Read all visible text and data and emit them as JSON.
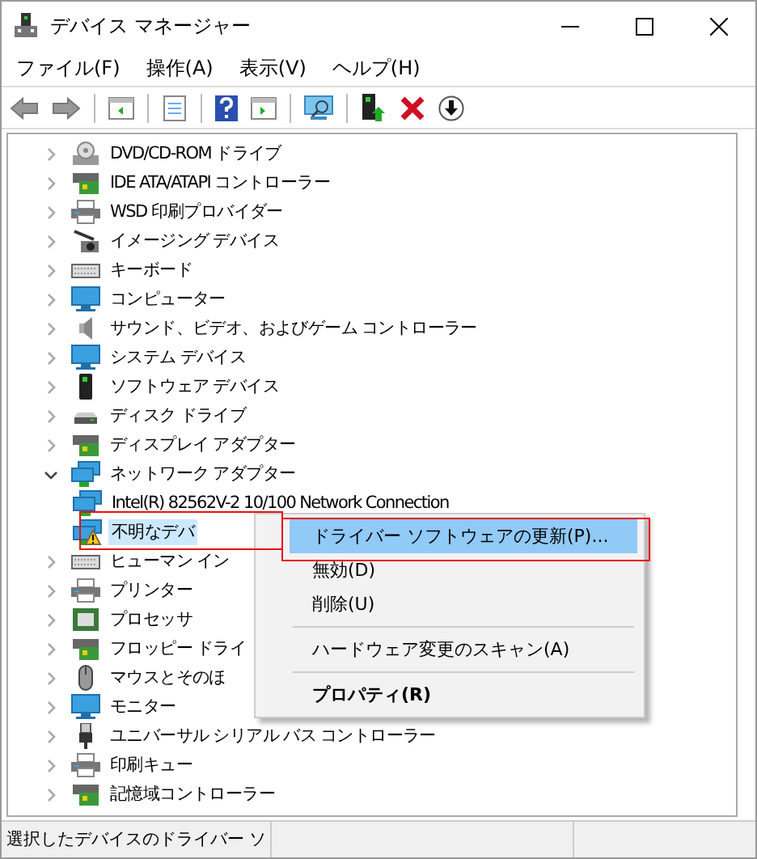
{
  "window": {
    "title": "デバイス マネージャー"
  },
  "menu": [
    "ファイル(F)",
    "操作(A)",
    "表示(V)",
    "ヘルプ(H)"
  ],
  "tree": [
    {
      "label": "DVD/CD-ROM ドライブ",
      "expanded": false
    },
    {
      "label": "IDE ATA/ATAPI コントローラー",
      "expanded": false
    },
    {
      "label": "WSD 印刷プロバイダー",
      "expanded": false
    },
    {
      "label": "イメージング デバイス",
      "expanded": false
    },
    {
      "label": "キーボード",
      "expanded": false
    },
    {
      "label": "コンピューター",
      "expanded": false
    },
    {
      "label": "サウンド、ビデオ、およびゲーム コントローラー",
      "expanded": false
    },
    {
      "label": "システム デバイス",
      "expanded": false
    },
    {
      "label": "ソフトウェア デバイス",
      "expanded": false
    },
    {
      "label": "ディスク ドライブ",
      "expanded": false
    },
    {
      "label": "ディスプレイ アダプター",
      "expanded": false
    },
    {
      "label": "ネットワーク アダプター",
      "expanded": true,
      "children": [
        {
          "label": "Intel(R) 82562V-2 10/100 Network Connection",
          "selected": false,
          "warning": false
        },
        {
          "label": "不明なデバ",
          "selected": true,
          "warning": true
        }
      ]
    },
    {
      "label": "ヒューマン イン",
      "expanded": false
    },
    {
      "label": "プリンター",
      "expanded": false
    },
    {
      "label": "プロセッサ",
      "expanded": false
    },
    {
      "label": "フロッピー ドライ",
      "expanded": false
    },
    {
      "label": "マウスとそのほ",
      "expanded": false
    },
    {
      "label": "モニター",
      "expanded": false
    },
    {
      "label": "ユニバーサル シリアル バス コントローラー",
      "expanded": false
    },
    {
      "label": "印刷キュー",
      "expanded": false
    },
    {
      "label": "記憶域コントローラー",
      "expanded": false
    }
  ],
  "context_menu": [
    [
      {
        "label": "ドライバー ソフトウェアの更新(P)...",
        "selected": true,
        "default": false
      },
      {
        "label": "無効(D)",
        "selected": false,
        "default": false
      },
      {
        "label": "削除(U)",
        "selected": false,
        "default": false
      }
    ],
    [
      {
        "label": "ハードウェア変更のスキャン(A)",
        "selected": false,
        "default": false
      }
    ],
    [
      {
        "label": "プロパティ(R)",
        "selected": false,
        "default": true
      }
    ]
  ],
  "status_bar": {
    "text": "選択したデバイスのドライバー ソ"
  }
}
